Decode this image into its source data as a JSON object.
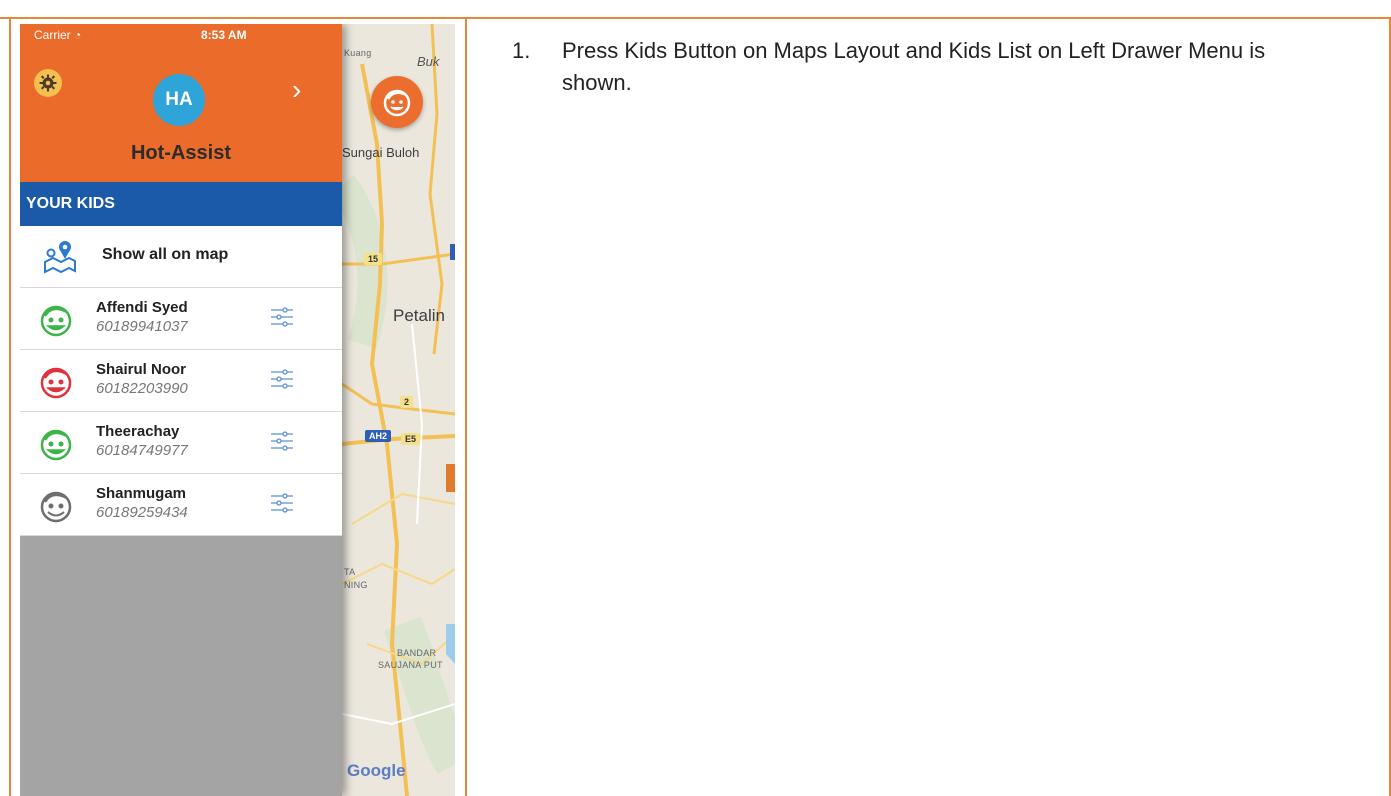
{
  "status_bar": {
    "carrier": "Carrier",
    "time": "8:53 AM"
  },
  "header": {
    "avatar_initials": "HA",
    "profile_name": "Hot-Assist",
    "settings_icon": "gear-icon",
    "next_icon": "chevron-right-icon"
  },
  "section_title": "YOUR KIDS",
  "show_all": {
    "label": "Show all on map",
    "icon": "map-pin-icon"
  },
  "kids": [
    {
      "name": "Affendi Syed",
      "phone": "60189941037",
      "color": "#3cb44a"
    },
    {
      "name": "Shairul Noor",
      "phone": "60182203990",
      "color": "#e0323c"
    },
    {
      "name": "Theerachay",
      "phone": "60184749977",
      "color": "#3cb44a"
    },
    {
      "name": "Shanmugam",
      "phone": "60189259434",
      "color": "#6e6e6e"
    }
  ],
  "map": {
    "labels": {
      "kuang": "Kuang",
      "buk": "Buk",
      "sungai_buloh": "Sungai Buloh",
      "petaling": "Petalin",
      "kota": "TA",
      "damansara": "NING",
      "bandar": "BANDAR",
      "saujana": "SAUJANA PUT"
    },
    "road_badges": {
      "r15": "15",
      "r2": "2",
      "ah2": "AH2",
      "e5": "E5"
    },
    "google": "Google",
    "fab_icon": "kid-face-icon"
  },
  "instruction": {
    "number": "1.",
    "text": "Press Kids Button on Maps Layout and Kids List on Left Drawer Menu is shown."
  },
  "colors": {
    "accent": "#ea6b2a",
    "section": "#1a5aa8",
    "avatar": "#2fa4d9",
    "border": "#e8863a"
  }
}
